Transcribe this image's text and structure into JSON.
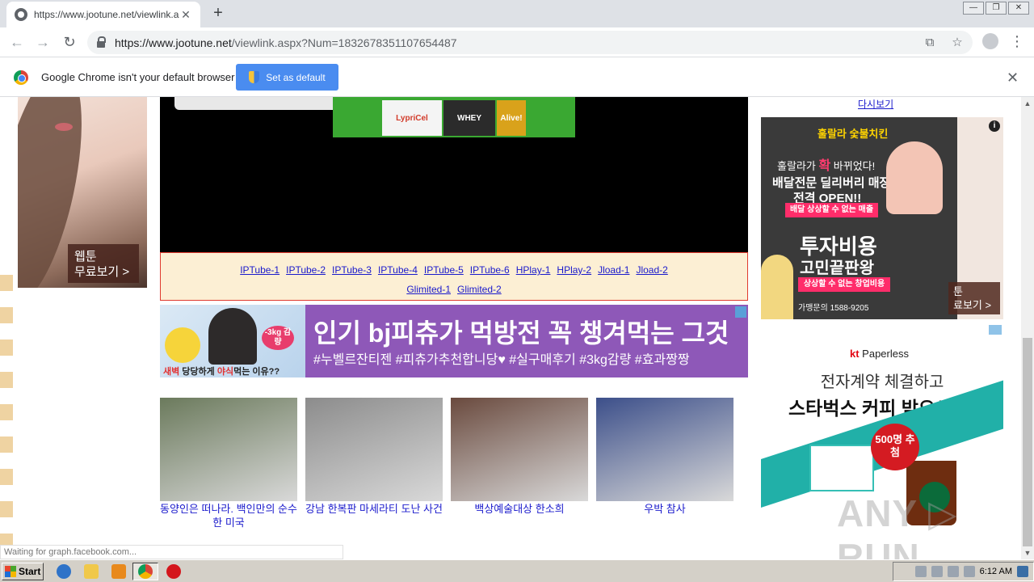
{
  "browser": {
    "tab_title": "https://www.jootune.net/viewlink.a",
    "tab_close": "✕",
    "new_tab": "+",
    "url_host": "https://www.jootune.net",
    "url_rest": "/viewlink.aspx?Num=1832678351107654487",
    "window_buttons": [
      "—",
      "❐",
      "✕"
    ]
  },
  "infobar": {
    "message": "Google Chrome isn't your default browser",
    "button": "Set as default",
    "close": "✕"
  },
  "left_ad": {
    "line1": "웹툰",
    "line2": "무료보기 >"
  },
  "video_ad": {
    "products": [
      "LypriCel",
      "WHEY",
      "Alive!"
    ]
  },
  "links": {
    "row1": [
      "IPTube-1",
      "IPTube-2",
      "IPTube-3",
      "IPTube-4",
      "IPTube-5",
      "IPTube-6",
      "HPlay-1",
      "HPlay-2",
      "Jload-1",
      "Jload-2"
    ],
    "row2": [
      "Glimited-1",
      "Glimited-2"
    ]
  },
  "banner": {
    "headline": "인기 bj피츄가 먹방전 꼭 챙겨먹는 그것",
    "tags": "#누벨르잔티젠 #피츄가추천합니당♥ #실구매후기 #3kg감량 #효과짱짱",
    "badge": "-3kg 감량",
    "caption_red1": "새벽",
    "caption_mid": " 당당하게 ",
    "caption_red2": "야식",
    "caption_end": "먹는 이유??"
  },
  "articles": [
    {
      "caption": "동양인은 떠나라. 백인만의 순수한 미국",
      "color": "#6b7a5c"
    },
    {
      "caption": "강남 한복판 마세라티 도난 사건",
      "color": "#8c8c8c"
    },
    {
      "caption": "백상예술대상 한소희",
      "color": "#6a4a3e"
    },
    {
      "caption": "우박 참사",
      "color": "#3c4f8a"
    }
  ],
  "right": {
    "link": "다시보기",
    "ad1": {
      "brand": "훌랄라 숯불치킨",
      "l1_pre": "훌랄라가 ",
      "l1_em": "확",
      "l1_post": " 바뀌었다!",
      "l2": "배달전문 딜리버리 매장",
      "l3": "전격 OPEN!!",
      "pill1": "배달 상상할 수 없는 매출",
      "big1": "투자비용",
      "big2": "고민끝판왕",
      "pill2": "상상할 수 없는 창업비용",
      "phone": "가맹문의 1588-9205",
      "info": "i",
      "webtoon1": "툰",
      "webtoon2": "료보기 >"
    },
    "ad2": {
      "brand_k": "kt",
      "brand_rest": " Paperless",
      "t1": "전자계약 체결하고",
      "t2": "스타벅스 커피 받으세요!",
      "badge": "500명 추첨"
    },
    "watermark": "ANY ▷ RUN"
  },
  "status": "Waiting for graph.facebook.com...",
  "taskbar": {
    "start": "Start",
    "time": "6:12 AM"
  }
}
